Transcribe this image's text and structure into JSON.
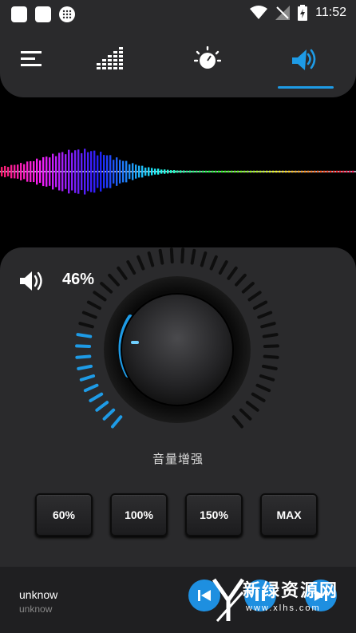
{
  "status_bar": {
    "time": "11:52"
  },
  "tabs": [
    {
      "icon": "menu-icon",
      "active": false
    },
    {
      "icon": "equalizer-icon",
      "active": false
    },
    {
      "icon": "bass-knob-icon",
      "active": false
    },
    {
      "icon": "speaker-icon",
      "active": true
    }
  ],
  "volume": {
    "percent_label": "46%",
    "level": 0.46
  },
  "boost": {
    "label": "音量增强"
  },
  "presets": [
    "60%",
    "100%",
    "150%",
    "MAX"
  ],
  "player": {
    "title": "unknow",
    "artist": "unknow"
  },
  "watermark": {
    "brand": "新绿资源网",
    "url": "www.xlhs.com"
  },
  "colors": {
    "accent": "#1e9be6",
    "panel": "#2a2a2c",
    "background": "#000000"
  }
}
